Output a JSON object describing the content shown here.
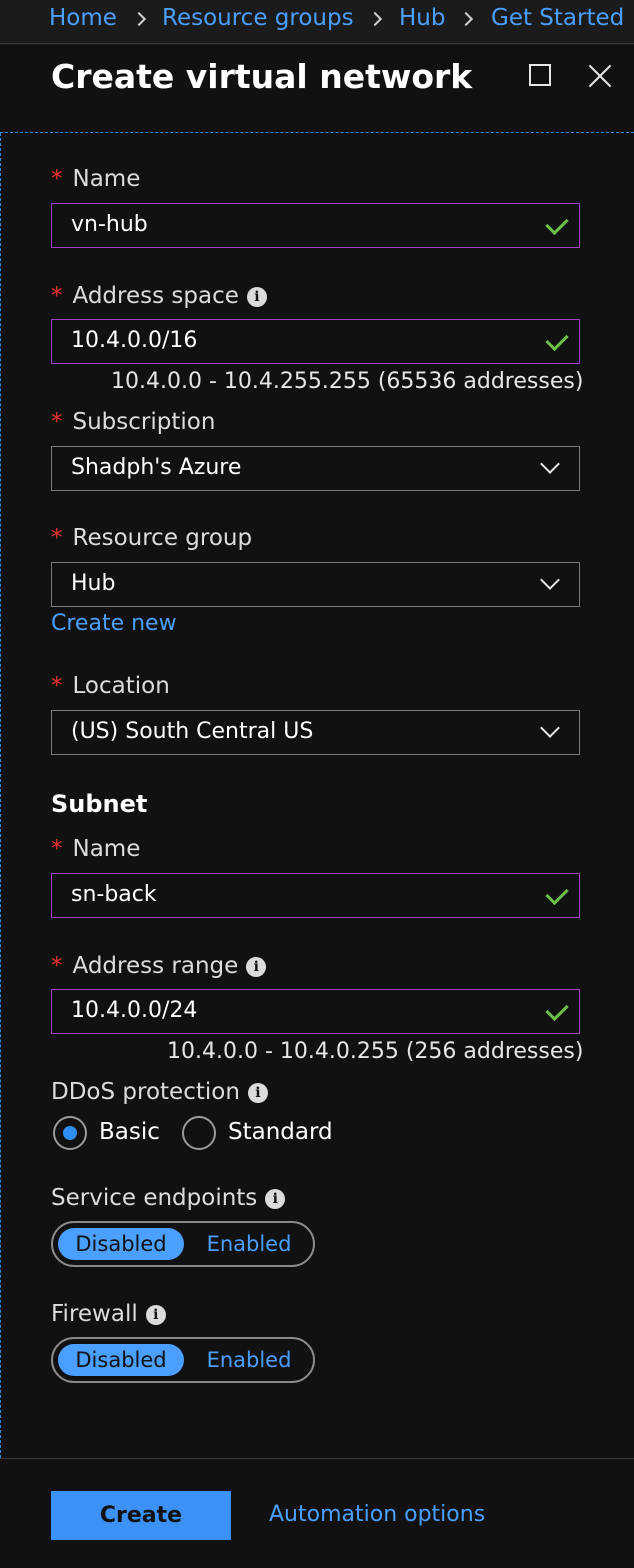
{
  "breadcrumb": [
    "Home",
    "Resource groups",
    "Hub",
    "Get Started"
  ],
  "blade": {
    "title": "Create virtual network"
  },
  "form": {
    "required_marker": "*",
    "name": {
      "label": "Name",
      "value": "vn-hub"
    },
    "address_space": {
      "label": "Address space",
      "value": "10.4.0.0/16",
      "hint": "10.4.0.0 - 10.4.255.255 (65536 addresses)"
    },
    "subscription": {
      "label": "Subscription",
      "value": "Shadph's Azure"
    },
    "resource_group": {
      "label": "Resource group",
      "value": "Hub",
      "create_new": "Create new"
    },
    "location": {
      "label": "Location",
      "value": "(US) South Central US"
    },
    "subnet": {
      "title": "Subnet",
      "name": {
        "label": "Name",
        "value": "sn-back"
      },
      "address_range": {
        "label": "Address range",
        "value": "10.4.0.0/24",
        "hint": "10.4.0.0 - 10.4.0.255 (256 addresses)"
      }
    },
    "ddos": {
      "label": "DDoS protection",
      "options": [
        "Basic",
        "Standard"
      ],
      "selected": "Basic"
    },
    "service_endpoints": {
      "label": "Service endpoints",
      "options": [
        "Disabled",
        "Enabled"
      ],
      "selected": "Disabled"
    },
    "firewall": {
      "label": "Firewall",
      "options": [
        "Disabled",
        "Enabled"
      ],
      "selected": "Disabled"
    }
  },
  "footer": {
    "create_label": "Create",
    "automation_label": "Automation options"
  },
  "colors": {
    "accent": "#4a9fff",
    "required": "#e8312f",
    "valid": "#6cc04a",
    "focus_border": "#a23fc4"
  },
  "icons": {
    "info": "i"
  }
}
